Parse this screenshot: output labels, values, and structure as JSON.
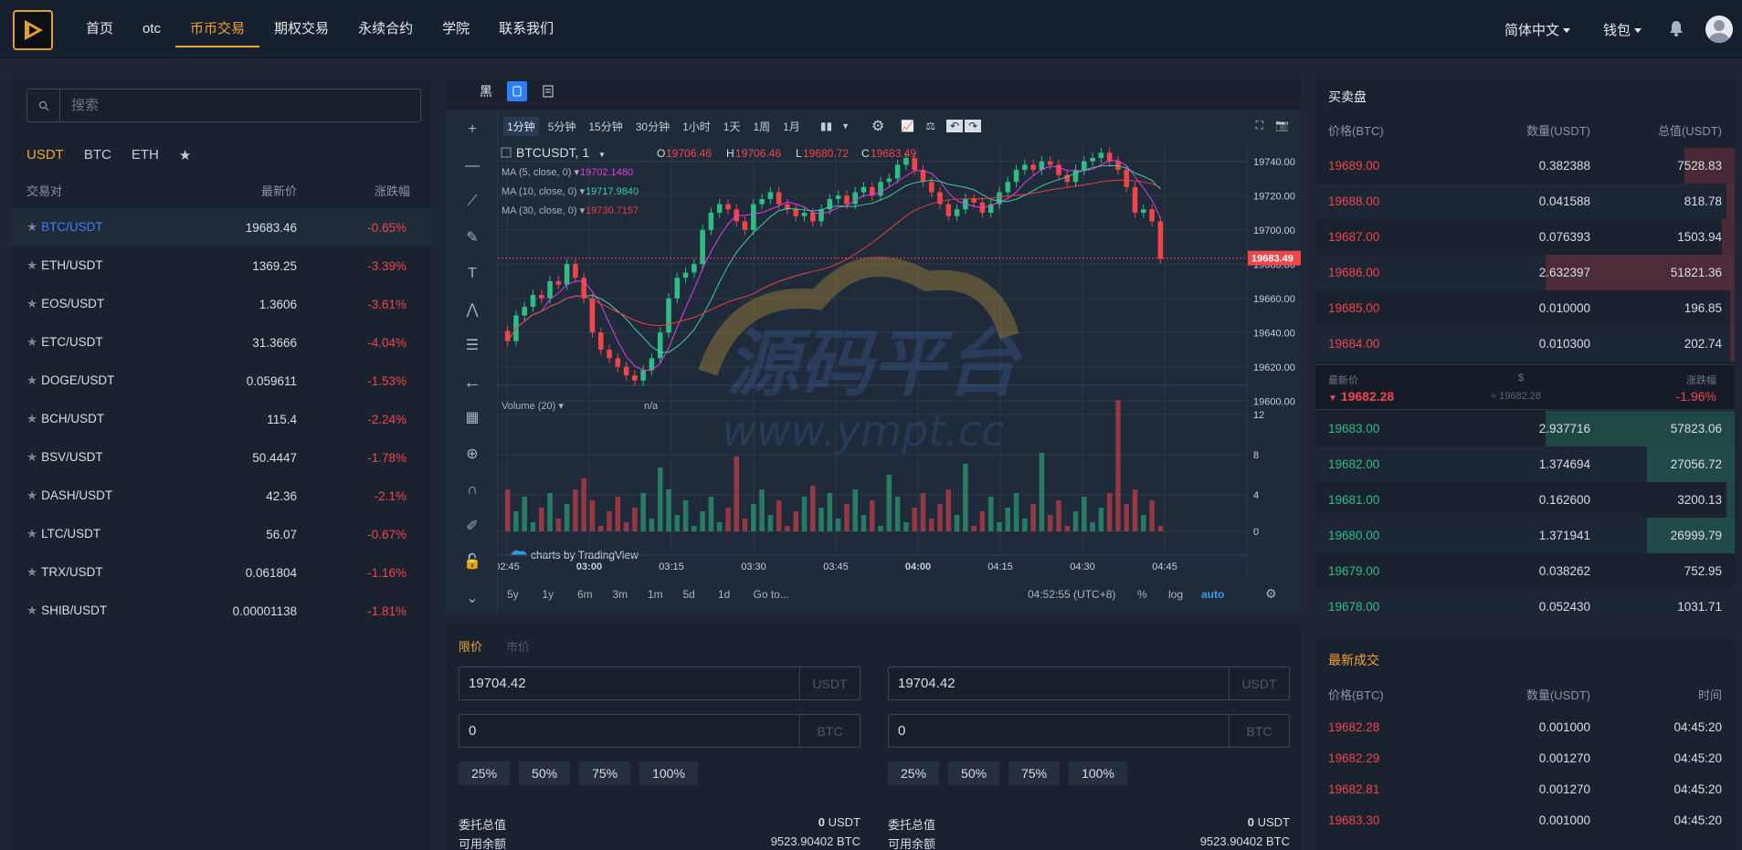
{
  "header": {
    "nav": [
      "首页",
      "otc",
      "币币交易",
      "期权交易",
      "永续合约",
      "学院",
      "联系我们"
    ],
    "active_nav": 2,
    "language": "简体中文",
    "wallet": "钱包"
  },
  "market": {
    "search_placeholder": "搜索",
    "tabs": [
      "USDT",
      "BTC",
      "ETH",
      "★"
    ],
    "columns": [
      "交易对",
      "最新价",
      "涨跌幅"
    ],
    "rows": [
      {
        "pair": "BTC/USDT",
        "price": "19683.46",
        "change": "-0.65%"
      },
      {
        "pair": "ETH/USDT",
        "price": "1369.25",
        "change": "-3.39%"
      },
      {
        "pair": "EOS/USDT",
        "price": "1.3606",
        "change": "-3.61%"
      },
      {
        "pair": "ETC/USDT",
        "price": "31.3666",
        "change": "-4.04%"
      },
      {
        "pair": "DOGE/USDT",
        "price": "0.059611",
        "change": "-1.53%"
      },
      {
        "pair": "BCH/USDT",
        "price": "115.4",
        "change": "-2.24%"
      },
      {
        "pair": "BSV/USDT",
        "price": "50.4447",
        "change": "-1.78%"
      },
      {
        "pair": "DASH/USDT",
        "price": "42.36",
        "change": "-2.1%"
      },
      {
        "pair": "LTC/USDT",
        "price": "56.07",
        "change": "-0.67%"
      },
      {
        "pair": "TRX/USDT",
        "price": "0.061804",
        "change": "-1.16%"
      },
      {
        "pair": "SHIB/USDT",
        "price": "0.00001138",
        "change": "-1.81%"
      }
    ]
  },
  "chart": {
    "theme_label": "黑",
    "intervals": [
      "1分钟",
      "5分钟",
      "15分钟",
      "30分钟",
      "1小时",
      "1天",
      "1周",
      "1月"
    ],
    "symbol": "BTCUSDT, 1",
    "ohlc": {
      "o": "19706.46",
      "h": "19706.46",
      "l": "19680.72",
      "c": "19683.49"
    },
    "indicators": [
      {
        "label": "MA (5, close, 0)",
        "value": "19702.1480",
        "color": "#e040e0"
      },
      {
        "label": "MA (10, close, 0)",
        "value": "19717.9840",
        "color": "#3fd0a0"
      },
      {
        "label": "MA (30, close, 0)",
        "value": "19730.7157",
        "color": "#e84040"
      }
    ],
    "volume_label": "Volume (20)",
    "volume_value": "n/a",
    "price_ticks": [
      "19740.00",
      "19720.00",
      "19700.00",
      "19680.00",
      "19660.00",
      "19640.00",
      "19620.00",
      "19600.00"
    ],
    "vol_ticks": [
      "12",
      "8",
      "4",
      "0"
    ],
    "time_ticks": [
      "02:45",
      "03:00",
      "03:15",
      "03:30",
      "03:45",
      "04:00",
      "04:15",
      "04:30",
      "04:45"
    ],
    "last_price": "19683.49",
    "watermark_cn": "源码平台",
    "watermark_url": "www.ympt.cc",
    "tv_brand": "charts by TradingView",
    "ranges": [
      "5y",
      "1y",
      "6m",
      "3m",
      "1m",
      "5d",
      "1d",
      "Go to..."
    ],
    "clock": "04:52:55 (UTC+8)",
    "scale_opts": [
      "%",
      "log",
      "auto"
    ],
    "chart_data": {
      "type": "candlestick",
      "ylim": [
        19590,
        19750
      ],
      "closes": [
        19635,
        19650,
        19655,
        19662,
        19660,
        19670,
        19668,
        19680,
        19672,
        19660,
        19640,
        19630,
        19625,
        19620,
        19615,
        19612,
        19618,
        19625,
        19640,
        19660,
        19672,
        19675,
        19680,
        19700,
        19710,
        19715,
        19712,
        19705,
        19700,
        19715,
        19718,
        19722,
        19715,
        19712,
        19708,
        19710,
        19705,
        19712,
        19718,
        19720,
        19715,
        19722,
        19725,
        19720,
        19728,
        19730,
        19738,
        19742,
        19735,
        19728,
        19722,
        19715,
        19708,
        19712,
        19718,
        19716,
        19710,
        19715,
        19722,
        19728,
        19735,
        19738,
        19735,
        19740,
        19738,
        19732,
        19728,
        19735,
        19740,
        19742,
        19745,
        19740,
        19735,
        19725,
        19710,
        19712,
        19705,
        19683
      ]
    }
  },
  "form": {
    "tabs": [
      "限价",
      "市价"
    ],
    "buy": {
      "price": "19704.42",
      "price_unit": "USDT",
      "amount": "0",
      "amount_unit": "BTC",
      "total_label": "委托总值",
      "total_value": "0",
      "total_unit": "USDT",
      "avail_label": "可用余额",
      "avail_value": "9523.90402 BTC"
    },
    "sell": {
      "price": "19704.42",
      "price_unit": "USDT",
      "amount": "0",
      "amount_unit": "BTC",
      "total_label": "委托总值",
      "total_value": "0",
      "total_unit": "USDT",
      "avail_label": "可用余额",
      "avail_value": "9523.90402 BTC"
    },
    "pcts": [
      "25%",
      "50%",
      "75%",
      "100%"
    ]
  },
  "orderbook": {
    "title": "买卖盘",
    "columns": [
      "价格(BTC)",
      "数量(USDT)",
      "总值(USDT)"
    ],
    "asks": [
      {
        "price": "19689.00",
        "qty": "0.382388",
        "total": "7528.83",
        "depth": 0.12
      },
      {
        "price": "19688.00",
        "qty": "0.041588",
        "total": "818.78",
        "depth": 0.02
      },
      {
        "price": "19687.00",
        "qty": "0.076393",
        "total": "1503.94",
        "depth": 0.03
      },
      {
        "price": "19686.00",
        "qty": "2.632397",
        "total": "51821.36",
        "depth": 0.45
      },
      {
        "price": "19685.00",
        "qty": "0.010000",
        "total": "196.85",
        "depth": 0.01
      },
      {
        "price": "19684.00",
        "qty": "0.010300",
        "total": "202.74",
        "depth": 0.01
      }
    ],
    "mid": {
      "label": "最新价",
      "usd_label": "$",
      "change_label": "涨跌幅",
      "price": "19682.28",
      "usd": "≈ 19682.28",
      "change": "-1.96%"
    },
    "bids": [
      {
        "price": "19683.00",
        "qty": "2.937716",
        "total": "57823.06",
        "depth": 0.45
      },
      {
        "price": "19682.00",
        "qty": "1.374694",
        "total": "27056.72",
        "depth": 0.21
      },
      {
        "price": "19681.00",
        "qty": "0.162600",
        "total": "3200.13",
        "depth": 0.02
      },
      {
        "price": "19680.00",
        "qty": "1.371941",
        "total": "26999.79",
        "depth": 0.21
      },
      {
        "price": "19679.00",
        "qty": "0.038262",
        "total": "752.95",
        "depth": 0.0
      },
      {
        "price": "19678.00",
        "qty": "0.052430",
        "total": "1031.71",
        "depth": 0.0
      }
    ]
  },
  "trades": {
    "title": "最新成交",
    "columns": [
      "价格(BTC)",
      "数量(USDT)",
      "时间"
    ],
    "rows": [
      {
        "price": "19682.28",
        "qty": "0.001000",
        "time": "04:45:20"
      },
      {
        "price": "19682.29",
        "qty": "0.001270",
        "time": "04:45:20"
      },
      {
        "price": "19682.81",
        "qty": "0.001270",
        "time": "04:45:20"
      },
      {
        "price": "19683.30",
        "qty": "0.001000",
        "time": "04:45:20"
      }
    ]
  },
  "colors": {
    "accent": "#f0a534",
    "up": "#2fbd85",
    "down": "#f0464a",
    "link": "#3b82f6"
  }
}
